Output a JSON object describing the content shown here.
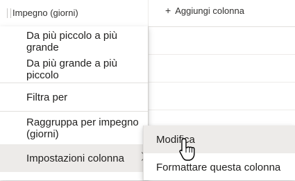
{
  "header": {
    "column_label": "Impegno (giorni)",
    "add_column_label": "Aggiungi colonna",
    "add_column_icon": "plus-icon"
  },
  "menu": {
    "items": [
      {
        "label": "Da più piccolo a più grande"
      },
      {
        "label": "Da più grande a più piccolo"
      },
      {
        "label": "Filtra per"
      },
      {
        "label": "Raggruppa per impegno (giorni)"
      },
      {
        "label": "Impostazioni colonna",
        "has_submenu": true,
        "hovered": true
      }
    ]
  },
  "submenu": {
    "items": [
      {
        "label": "Modifica",
        "hovered": true
      },
      {
        "label": "Formattare questa colonna"
      }
    ]
  },
  "colors": {
    "hover_background": "#edebe9",
    "text": "#201f1e"
  }
}
